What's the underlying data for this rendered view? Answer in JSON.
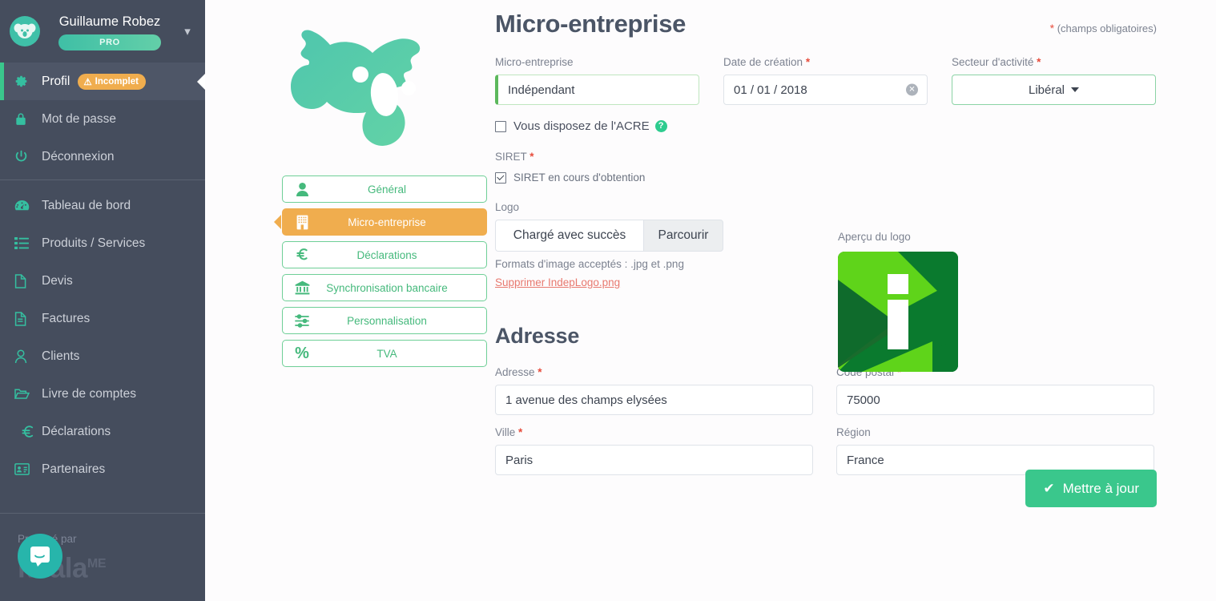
{
  "sidebar": {
    "user_name": "Guillaume Robez",
    "plan_badge": "PRO",
    "caret_icon": "chevron-down-icon",
    "items": [
      {
        "label": "Profil",
        "icon": "gear-icon",
        "active": true,
        "badge": "Incomplet"
      },
      {
        "label": "Mot de passe",
        "icon": "lock-icon",
        "active": false
      },
      {
        "label": "Déconnexion",
        "icon": "power-icon",
        "active": false
      },
      {
        "label": "Tableau de bord",
        "icon": "dashboard-icon",
        "active": false
      },
      {
        "label": "Produits / Services",
        "icon": "list-icon",
        "active": false
      },
      {
        "label": "Devis",
        "icon": "file-icon",
        "active": false
      },
      {
        "label": "Factures",
        "icon": "invoice-icon",
        "active": false
      },
      {
        "label": "Clients",
        "icon": "user-icon",
        "active": false
      },
      {
        "label": "Livre de comptes",
        "icon": "folder-open-icon",
        "active": false
      },
      {
        "label": "Déclarations",
        "icon": "euro-icon",
        "active": false
      },
      {
        "label": "Partenaires",
        "icon": "id-card-icon",
        "active": false
      }
    ],
    "footer": {
      "proposed_by": "Proposé par",
      "brand": "koala",
      "brand_sup": "ME"
    },
    "intercom_icon": "chat-bubble-icon"
  },
  "tabs": [
    {
      "label": "Général",
      "icon": "person-icon",
      "selected": false
    },
    {
      "label": "Micro-entreprise",
      "icon": "building-icon",
      "selected": true
    },
    {
      "label": "Déclarations",
      "icon": "euro-icon",
      "selected": false
    },
    {
      "label": "Synchronisation bancaire",
      "icon": "bank-icon",
      "selected": false
    },
    {
      "label": "Personnalisation",
      "icon": "sliders-icon",
      "selected": false
    },
    {
      "label": "TVA",
      "icon": "percent-icon",
      "selected": false
    }
  ],
  "page": {
    "title": "Micro-entreprise",
    "required_note_star": "*",
    "required_note": "(champs obligatoires)"
  },
  "form": {
    "micro_entreprise": {
      "label": "Micro-entreprise",
      "value": "Indépendant",
      "placeholder": ""
    },
    "date_creation": {
      "label": "Date de création",
      "required": "*",
      "value": "01 / 01 / 2018",
      "clear_icon": "clear-icon"
    },
    "secteur": {
      "label": "Secteur d'activité",
      "required": "*",
      "value": "Libéral",
      "caret_icon": "chevron-down-icon"
    },
    "acre": {
      "label": "Vous disposez de l'ACRE",
      "checked": false,
      "help_icon": "question-icon"
    },
    "siret": {
      "label": "SIRET",
      "required": "*",
      "checkbox_label": "SIRET en cours d'obtention",
      "checked": true
    },
    "logo": {
      "label": "Logo",
      "file_name": "Chargé avec succès",
      "browse_label": "Parcourir",
      "hint": "Formats d'image acceptés : .jpg et .png",
      "delete_link": "Supprimer IndepLogo.png"
    },
    "logo_preview": {
      "label": "Aperçu du logo",
      "alt": "logo-i-green"
    }
  },
  "address": {
    "title": "Adresse",
    "fields": [
      {
        "label": "Adresse",
        "required": "*",
        "value": "1 avenue des champs elysées"
      },
      {
        "label": "Code postal",
        "required": "*",
        "value": "75000"
      },
      {
        "label": "Ville",
        "required": "*",
        "value": "Paris"
      },
      {
        "label": "Région",
        "required": "",
        "value": "France"
      }
    ]
  },
  "actions": {
    "update_label": "Mettre à jour",
    "update_icon": "check-icon"
  },
  "colors": {
    "sidebar_bg": "#454d5d",
    "sidebar_active": "#4e5667",
    "accent_green": "#3ac78c",
    "teal": "#3fc0a8",
    "orange": "#f0ad4e",
    "required_red": "#e74c3c",
    "link_red": "#e8796f"
  }
}
